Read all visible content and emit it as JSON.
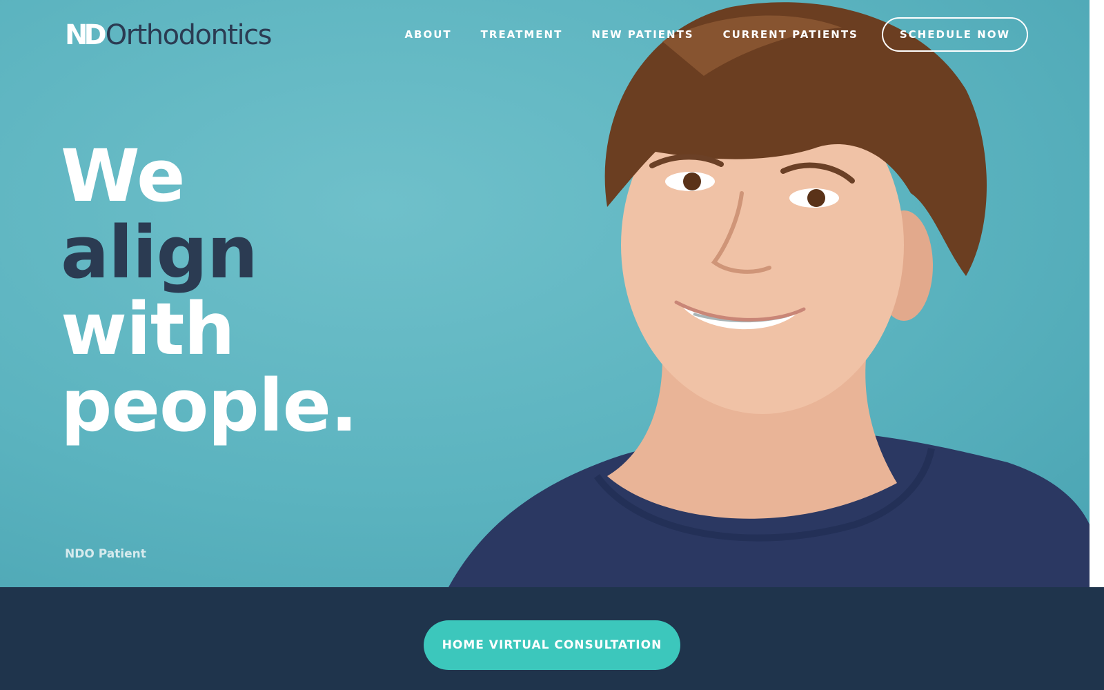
{
  "brand": {
    "mark": "ND",
    "name": "Orthodontics"
  },
  "nav": {
    "items": [
      {
        "label": "ABOUT"
      },
      {
        "label": "TREATMENT"
      },
      {
        "label": "NEW PATIENTS"
      },
      {
        "label": "CURRENT PATIENTS"
      }
    ],
    "cta_label": "SCHEDULE NOW"
  },
  "hero": {
    "headline": {
      "line1": "We",
      "line2": "align",
      "line3": "with",
      "line4": "people."
    },
    "caption": "NDO Patient",
    "image": "smiling-boy-with-braces-photo"
  },
  "band": {
    "button_label": "HOME VIRTUAL CONSULTATION"
  },
  "colors": {
    "hero_background": "#5bb3bf",
    "brand_dark": "#2b3b52",
    "band_background": "#1f344c",
    "accent": "#3cc7bc",
    "shirt": "#2b3862"
  }
}
